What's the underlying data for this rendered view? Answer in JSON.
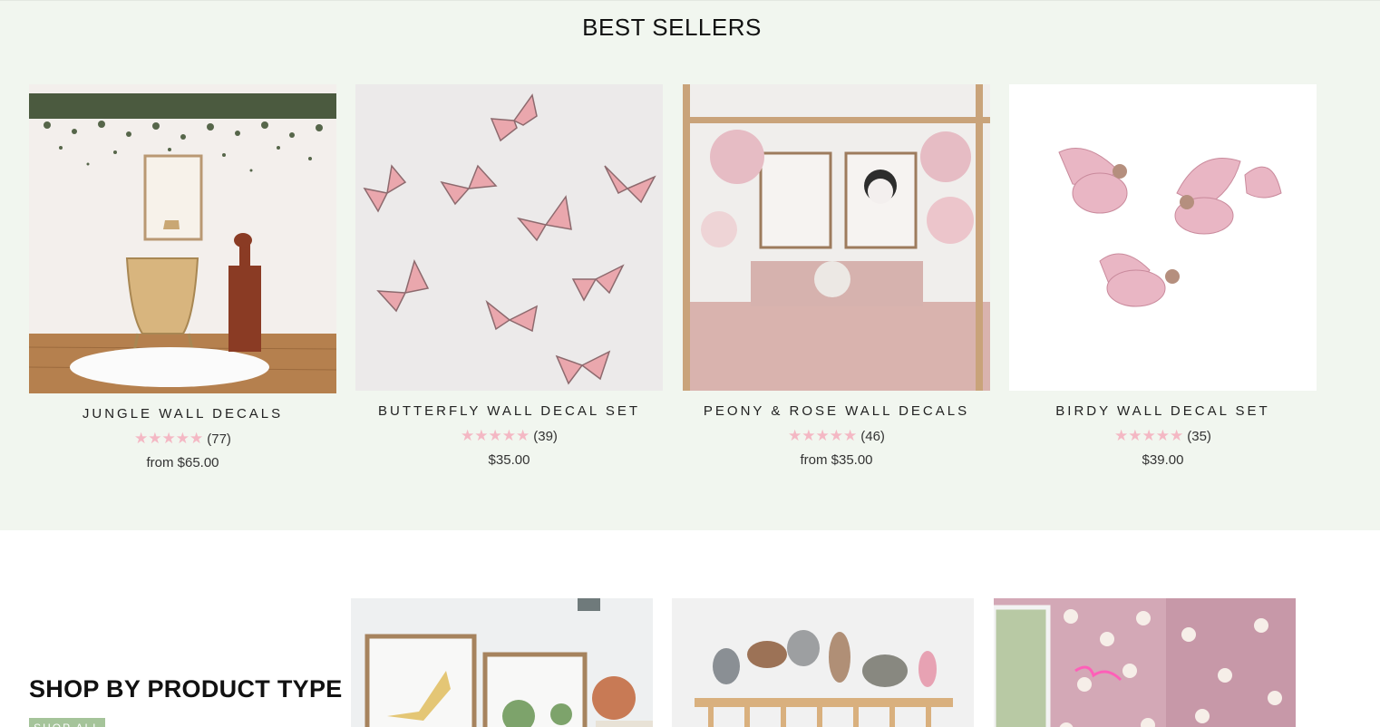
{
  "best_sellers": {
    "title": "BEST SELLERS",
    "products": [
      {
        "name": "JUNGLE WALL DECALS",
        "stars": "★★★★★",
        "reviews": "(77)",
        "price": "from $65.00"
      },
      {
        "name": "BUTTERFLY WALL DECAL SET",
        "stars": "★★★★★",
        "reviews": "(39)",
        "price": "$35.00"
      },
      {
        "name": "PEONY & ROSE WALL DECALS",
        "stars": "★★★★★",
        "reviews": "(46)",
        "price": "from $35.00"
      },
      {
        "name": "BIRDY WALL DECAL SET",
        "stars": "★★★★★",
        "reviews": "(35)",
        "price": "$39.00"
      }
    ],
    "background": "#f1f6ef",
    "star_color": "#f4b8c4"
  },
  "shop_by_type": {
    "title": "SHOP BY PRODUCT TYPE",
    "button_label": "SHOP ALL",
    "button_color": "#a5c49a"
  }
}
